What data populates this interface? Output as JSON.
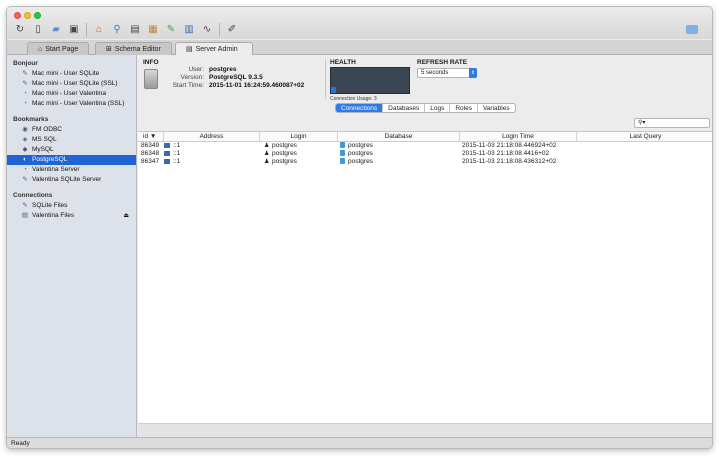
{
  "tabs": [
    {
      "label": "Start Page",
      "icon": "home-icon"
    },
    {
      "label": "Schema Editor",
      "icon": "schema-icon"
    },
    {
      "label": "Server Admin",
      "icon": "server-icon"
    }
  ],
  "sidebar": {
    "groups": [
      {
        "title": "Bonjour",
        "items": [
          {
            "label": "Mac mini - User SQLite",
            "icon": "sqlite-icon"
          },
          {
            "label": "Mac mini - User SQLite (SSL)",
            "icon": "sqlite-icon"
          },
          {
            "label": "Mac mini - User Valentina",
            "icon": "valentina-icon"
          },
          {
            "label": "Mac mini - User Valentina (SSL)",
            "icon": "valentina-icon"
          }
        ]
      },
      {
        "title": "Bookmarks",
        "items": [
          {
            "label": "FM ODBC",
            "icon": "odbc-icon"
          },
          {
            "label": "MS SQL",
            "icon": "mssql-icon"
          },
          {
            "label": "MySQL",
            "icon": "mysql-icon"
          },
          {
            "label": "PostgreSQL",
            "icon": "postgresql-icon",
            "selected": true
          },
          {
            "label": "Valentina Server",
            "icon": "valentina-icon"
          },
          {
            "label": "Valentina SQLite Server",
            "icon": "sqlite-icon"
          }
        ]
      },
      {
        "title": "Connections",
        "items": [
          {
            "label": "SQLite Files",
            "icon": "sqlite-icon"
          },
          {
            "label": "Valentina Files",
            "icon": "file-icon",
            "eject": true
          }
        ]
      }
    ]
  },
  "info": {
    "title": "INFO",
    "user_label": "User:",
    "user": "postgres",
    "version_label": "Version:",
    "version": "PostgreSQL 9.3.5",
    "start_label": "Start Time:",
    "start_time": "2015-11-01 16:24:59.460087+02"
  },
  "health": {
    "title": "HEALTH",
    "usage_text": "Connection Usage: 3",
    "usage_level": 0.06
  },
  "refresh": {
    "title": "REFRESH RATE",
    "value": "5 seconds"
  },
  "segments": [
    {
      "label": "Connections",
      "active": true
    },
    {
      "label": "Databases"
    },
    {
      "label": "Logs"
    },
    {
      "label": "Roles"
    },
    {
      "label": "Variables"
    }
  ],
  "search": {
    "placeholder": ""
  },
  "table": {
    "columns": [
      "id",
      "Address",
      "Login",
      "Database",
      "Login Time",
      "Last Query"
    ],
    "sort_indicator": "▼",
    "rows": [
      {
        "id": "86349",
        "address": "::1",
        "login": "postgres",
        "database": "postgres",
        "login_time": "2015-11-03 21:18:08.446924+02",
        "last_query": ""
      },
      {
        "id": "86348",
        "address": "::1",
        "login": "postgres",
        "database": "postgres",
        "login_time": "2015-11-03 21:18:08.4416+02",
        "last_query": ""
      },
      {
        "id": "86347",
        "address": "::1",
        "login": "postgres",
        "database": "postgres",
        "login_time": "2015-11-03 21:18:08.436312+02",
        "last_query": ""
      }
    ]
  },
  "status": "Ready",
  "colors": {
    "accent": "#2f7ae6",
    "selection": "#1f63d4",
    "sidebar": "#dde2ea"
  }
}
